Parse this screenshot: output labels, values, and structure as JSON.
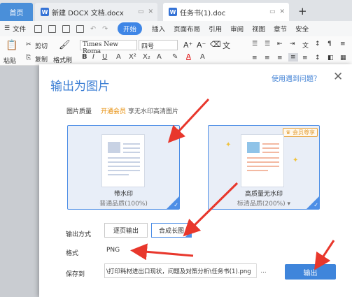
{
  "tabs": [
    {
      "label": "首页"
    },
    {
      "label": "新建 DOCX 文档.docx"
    },
    {
      "label": "任务书(1).doc"
    }
  ],
  "new_tab_symbol": "+",
  "menu": {
    "file": "文件",
    "items": [
      "开始",
      "插入",
      "页面布局",
      "引用",
      "审阅",
      "视图",
      "章节",
      "安全"
    ]
  },
  "ribbon": {
    "paste": "粘贴",
    "cut": "剪切",
    "copy": "复制",
    "format_painter": "格式刷",
    "font_name": "Times New Roma",
    "font_size": "四号",
    "font_grow": "A⁺",
    "font_shrink": "A⁻"
  },
  "dialog": {
    "title": "输出为图片",
    "help_link": "使用遇到问题？",
    "close_symbol": "╳",
    "quality_label": "图片质量",
    "member_link": "开通会员",
    "member_desc": "享无水印高清图片",
    "card_watermark": {
      "name": "带水印",
      "quality": "普通品质(100%)"
    },
    "card_hq": {
      "name": "高质量无水印",
      "quality": "标清品质(200%)",
      "badge": "会员尊享"
    },
    "output_mode_label": "输出方式",
    "mode_page": "逐页输出",
    "mode_long": "合成长图",
    "format_label": "格式",
    "format_value": "PNG",
    "saveto_label": "保存到",
    "save_path": "\\打印耗材进出口现状，问题及对策分析\\任务书(1).png",
    "browse": "...",
    "export": "输出"
  },
  "colors": {
    "accent": "#3f85db",
    "arrow": "#e8372c",
    "member": "#e68a00"
  }
}
